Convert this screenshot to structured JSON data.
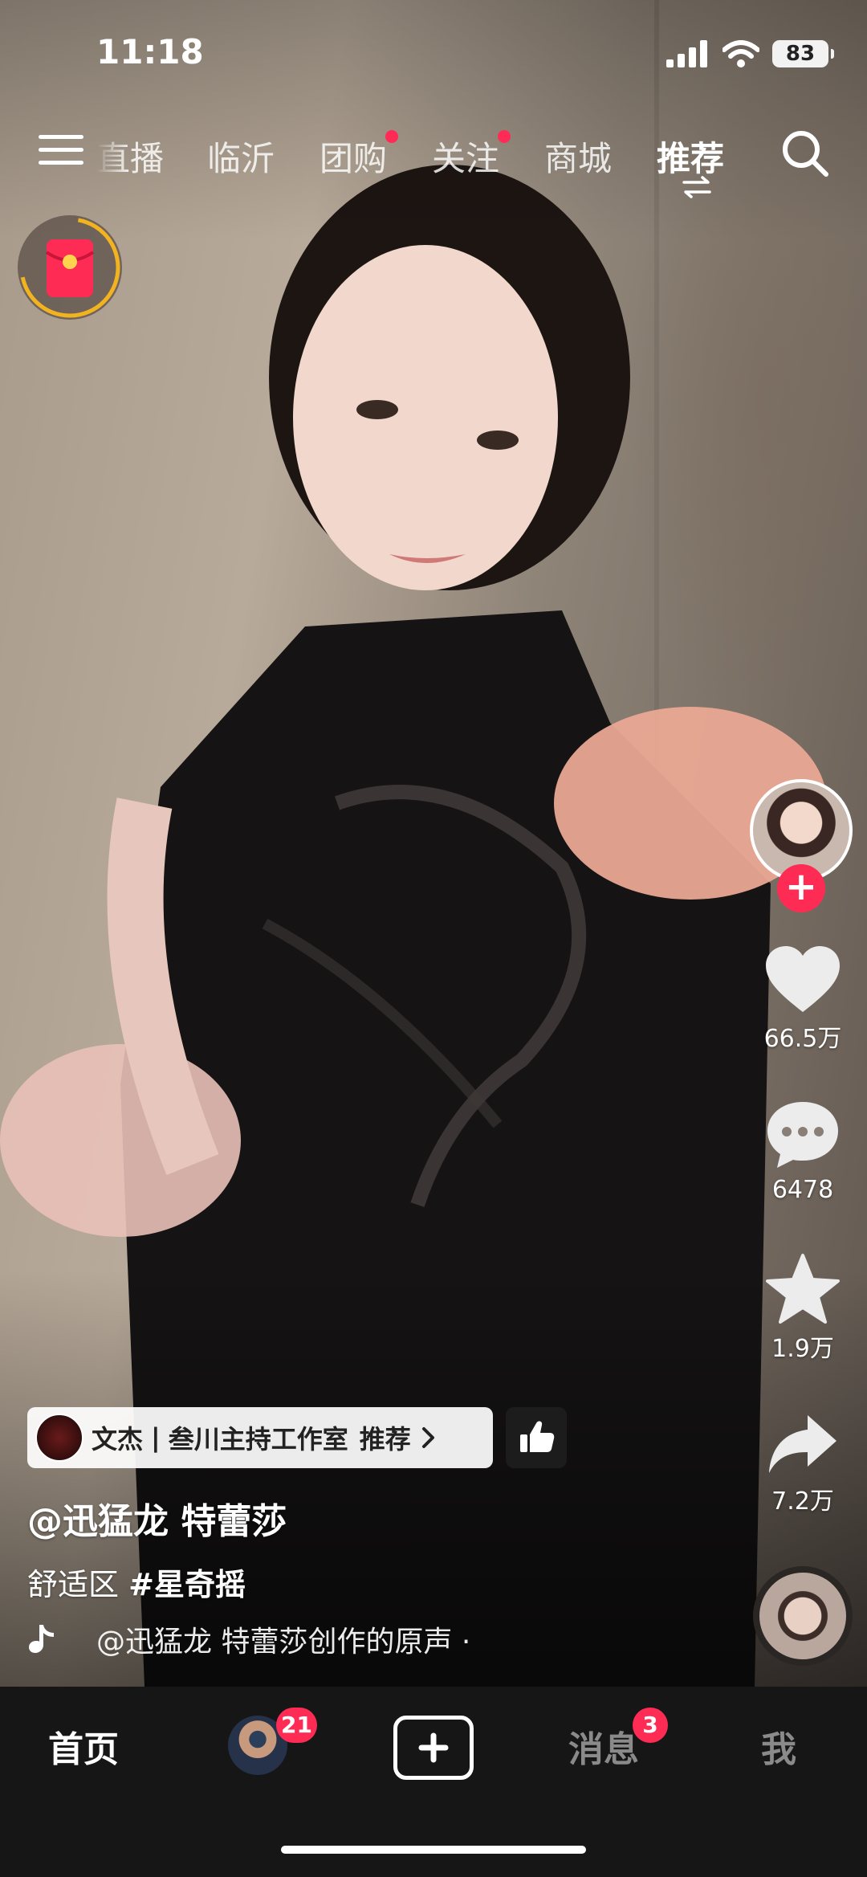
{
  "status_bar": {
    "time": "11:18",
    "battery": "83"
  },
  "top_nav": {
    "tabs": [
      {
        "label": "直播",
        "partial": true
      },
      {
        "label": "临沂"
      },
      {
        "label": "团购",
        "dot": true
      },
      {
        "label": "关注",
        "dot": true
      },
      {
        "label": "商城"
      },
      {
        "label": "推荐",
        "active": true
      }
    ]
  },
  "right_rail": {
    "like_count": "66.5万",
    "comment_count": "6478",
    "favorite_count": "1.9万",
    "share_count": "7.2万"
  },
  "video_info": {
    "recommend_pill": {
      "name": "文杰",
      "separator": "|",
      "studio": "叁川主持工作室",
      "action": "推荐"
    },
    "author": "@迅猛龙 特蕾莎",
    "caption_prefix": "舒适区",
    "hashtag": "#星奇摇",
    "music": "@迅猛龙 特蕾莎创作的原声 ·"
  },
  "tab_bar": {
    "home": "首页",
    "friends_badge": "21",
    "messages": "消息",
    "messages_badge": "3",
    "me": "我"
  },
  "colors": {
    "accent": "#fe2c55",
    "tabbar_bg": "#161616"
  }
}
